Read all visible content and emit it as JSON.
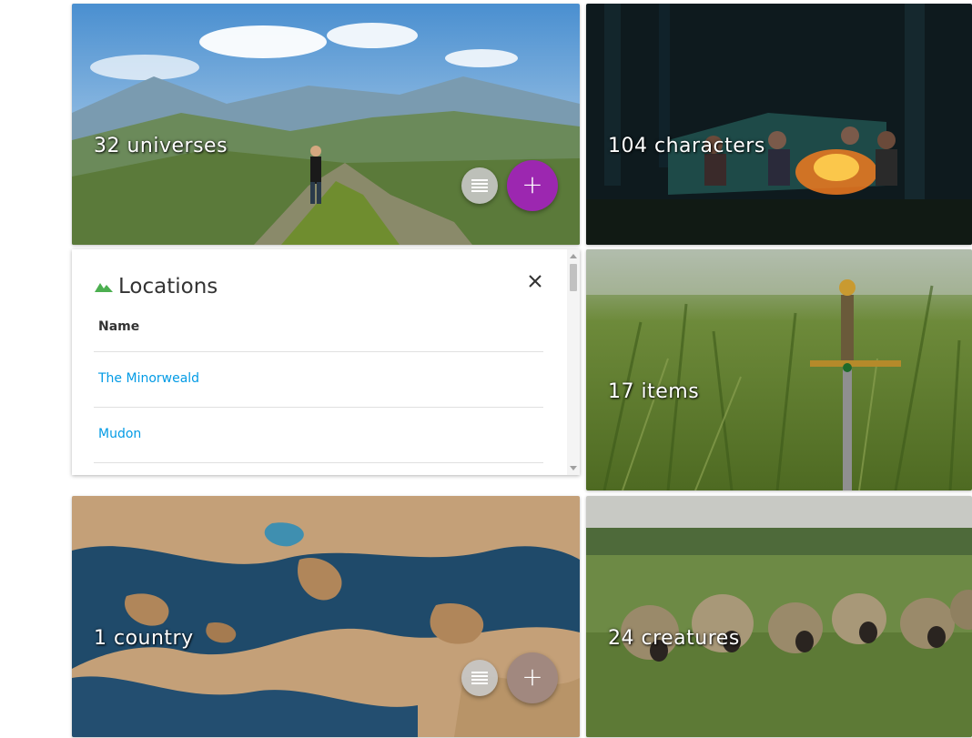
{
  "colors": {
    "add_universe_button": "#9c27b0",
    "add_country_button": "#a1887f",
    "link": "#039be5",
    "locations_icon": "#4caf50"
  },
  "cards": {
    "universes": {
      "title": "32 universes",
      "list_icon": "list-icon",
      "add_icon": "plus-icon",
      "add_label": "+"
    },
    "characters": {
      "title": "104 characters"
    },
    "items": {
      "title": "17 items"
    },
    "countries": {
      "title": "1 country",
      "list_icon": "list-icon",
      "add_icon": "plus-icon",
      "add_label": "+"
    },
    "creatures": {
      "title": "24 creatures"
    }
  },
  "locations_panel": {
    "icon": "terrain-icon",
    "title": "Locations",
    "close_icon": "close-icon",
    "column_header": "Name",
    "rows": [
      "The Minorweald",
      "Mudon"
    ]
  }
}
